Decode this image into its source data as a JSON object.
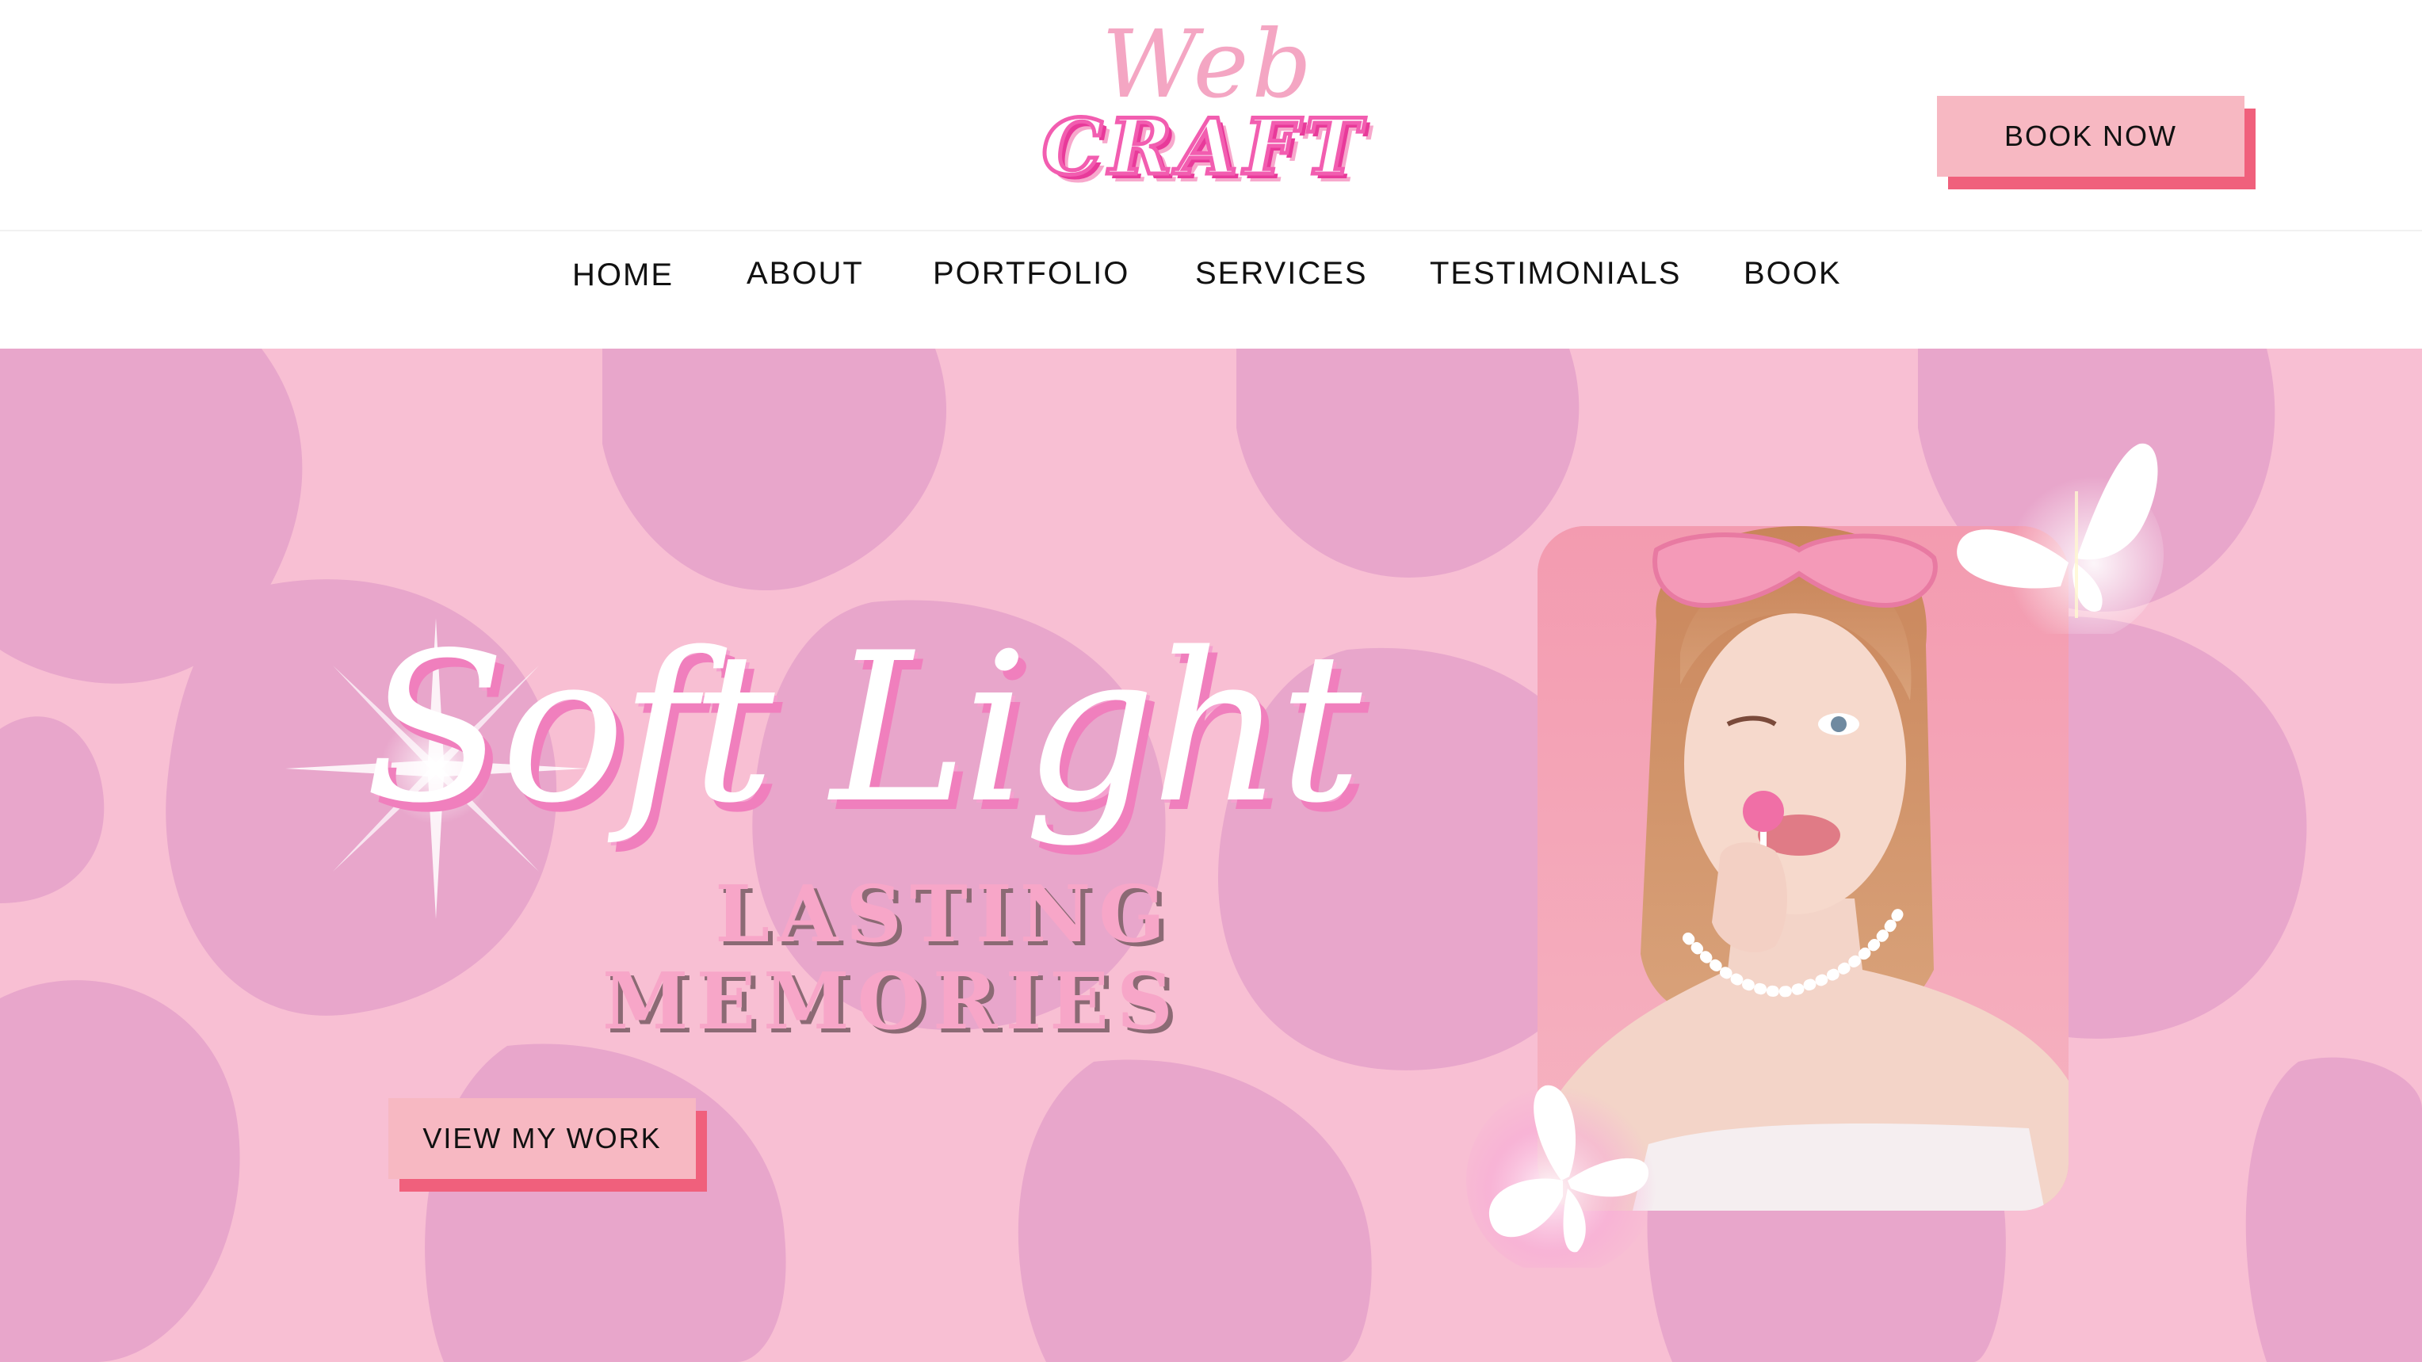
{
  "header": {
    "logo_line1": "Web",
    "logo_line2": "CRAFT",
    "book_now_label": "BOOK NOW"
  },
  "nav": {
    "items": [
      {
        "label": "HOME"
      },
      {
        "label": "ABOUT"
      },
      {
        "label": "PORTFOLIO"
      },
      {
        "label": "SERVICES"
      },
      {
        "label": "TESTIMONIALS"
      },
      {
        "label": "BOOK"
      }
    ]
  },
  "hero": {
    "headline": "Soft Light",
    "tagline_line1": "LASTING",
    "tagline_line2": "MEMORIES",
    "cta_label": "VIEW MY WORK",
    "photo_icon": "portrait-photo",
    "decor_icons": [
      "sparkle-icon",
      "butterfly-icon"
    ]
  },
  "colors": {
    "button_fill": "#f7b8c2",
    "button_shadow": "#f0607c",
    "hero_light": "#f8bfd3",
    "hero_dark": "#e8a6cb",
    "logo_pink": "#f25db0"
  }
}
